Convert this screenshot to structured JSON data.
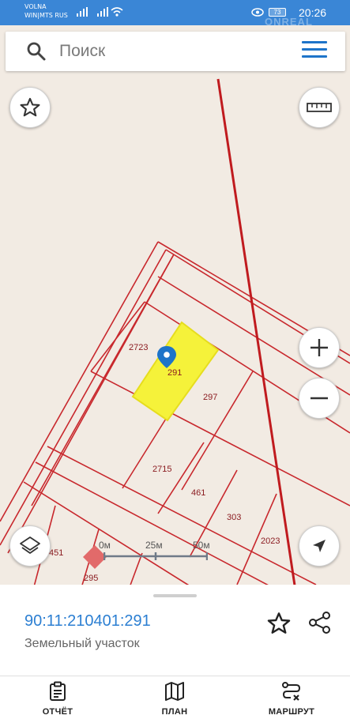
{
  "status_bar": {
    "carrier_1": "VOLNA",
    "carrier_2": "WIN|MTS RUS",
    "battery": "73",
    "time": "20:26",
    "watermark": "ONREAL"
  },
  "search": {
    "placeholder": "Поиск"
  },
  "map": {
    "parcel_labels": [
      "2723",
      "291",
      "297",
      "2715",
      "461",
      "303",
      "2023",
      "451",
      "295"
    ],
    "highlight_color": "#f5f23a",
    "boundary_color": "#c8282d",
    "scale": {
      "labels": [
        "0м",
        "25м",
        "50м"
      ]
    }
  },
  "selected_object": {
    "cadastral_number": "90:11:210401:291",
    "type": "Земельный участок"
  },
  "bottom_nav": {
    "items": [
      {
        "label": "ОТЧЁТ",
        "icon": "report-icon"
      },
      {
        "label": "ПЛАН",
        "icon": "map-plan-icon"
      },
      {
        "label": "МАРШРУТ",
        "icon": "route-icon"
      }
    ]
  }
}
